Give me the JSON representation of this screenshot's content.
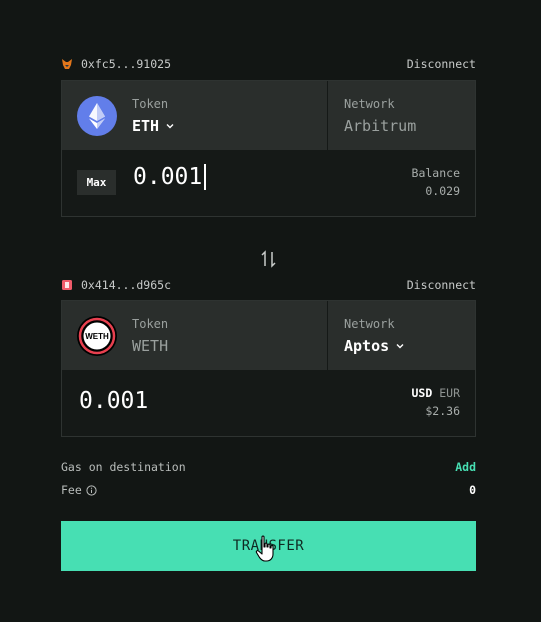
{
  "source": {
    "wallet_address": "0xfc5...91025",
    "disconnect_label": "Disconnect",
    "token_label": "Token",
    "token_value": "ETH",
    "network_label": "Network",
    "network_value": "Arbitrum",
    "max_label": "Max",
    "amount": "0.001",
    "balance_label": "Balance",
    "balance_value": "0.029"
  },
  "destination": {
    "wallet_address": "0x414...d965c",
    "disconnect_label": "Disconnect",
    "token_label": "Token",
    "token_value": "WETH",
    "token_logo_text": "WETH",
    "network_label": "Network",
    "network_value": "Aptos",
    "amount": "0.001",
    "currency_active": "USD",
    "currency_inactive": "EUR",
    "fiat_value": "$2.36"
  },
  "gas": {
    "label": "Gas on destination",
    "action": "Add"
  },
  "fee": {
    "label": "Fee",
    "value": "0"
  },
  "transfer_label": "TRANSFER",
  "colors": {
    "accent": "#47dfb3",
    "background": "#121614",
    "panel": "#2a2e2c",
    "eth": "#627eea"
  },
  "icons": [
    "metamask-icon",
    "petra-icon",
    "eth-logo-icon",
    "weth-logo-icon",
    "chevron-down-icon",
    "swap-arrows-icon",
    "info-icon",
    "hand-cursor-icon"
  ]
}
